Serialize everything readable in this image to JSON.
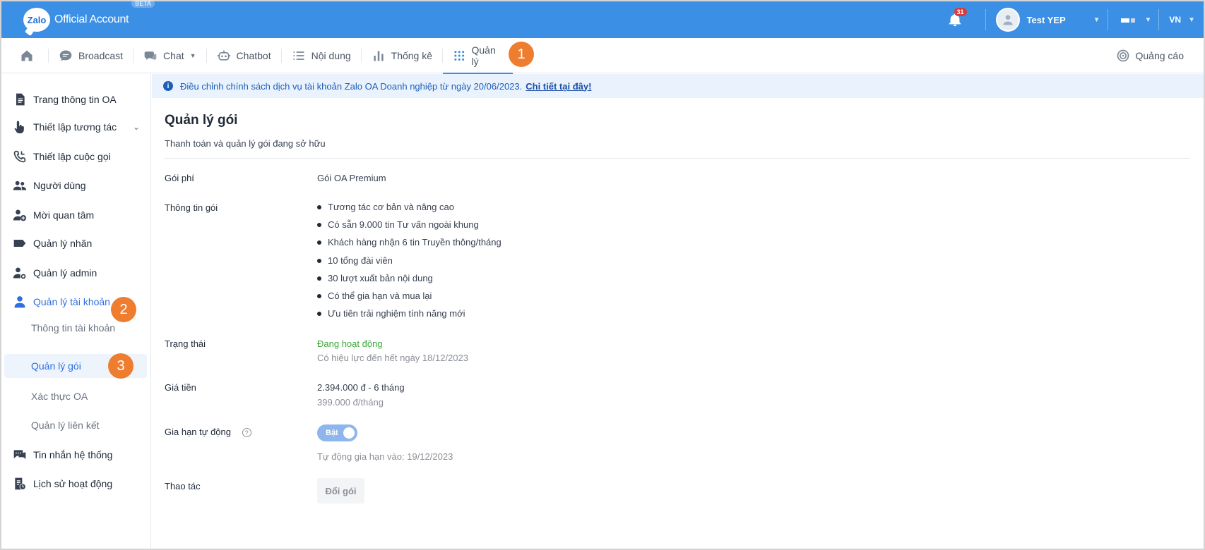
{
  "header": {
    "logo_text": "Zalo",
    "app_name": "Official Account",
    "beta": "BETA",
    "notification_count": "31",
    "user_name": "Test YEP",
    "language": "VN"
  },
  "nav": {
    "items": [
      {
        "label": "Broadcast"
      },
      {
        "label": "Chat"
      },
      {
        "label": "Chatbot"
      },
      {
        "label": "Nội dung"
      },
      {
        "label": "Thống kê"
      },
      {
        "label": "Quản lý"
      }
    ],
    "right_label": "Quảng cáo"
  },
  "callouts": [
    "1",
    "2",
    "3"
  ],
  "sidebar": {
    "items": [
      {
        "label": "Trang thông tin OA"
      },
      {
        "label": "Thiết lập tương tác"
      },
      {
        "label": "Thiết lập cuộc gọi"
      },
      {
        "label": "Người dùng"
      },
      {
        "label": "Mời quan tâm"
      },
      {
        "label": "Quản lý nhãn"
      },
      {
        "label": "Quản lý admin"
      },
      {
        "label": "Quản lý tài khoản"
      },
      {
        "label": "Thông tin tài khoản"
      },
      {
        "label": "Quản lý gói"
      },
      {
        "label": "Xác thực OA"
      },
      {
        "label": "Quản lý liên kết"
      },
      {
        "label": "Tin nhắn hệ thống"
      },
      {
        "label": "Lịch sử hoạt động"
      }
    ]
  },
  "banner": {
    "text": "Điều chỉnh chính sách dịch vụ tài khoản Zalo OA Doanh nghiệp từ ngày 20/06/2023.",
    "link": "Chi tiết tại đây!"
  },
  "main": {
    "title": "Quản lý gói",
    "subtitle": "Thanh toán và quản lý gói đang sở hữu",
    "fields": {
      "package_label": "Gói phí",
      "package_value": "Gói OA Premium",
      "info_label": "Thông tin gói",
      "info_items": [
        "Tương tác cơ bản và nâng cao",
        "Có sẵn 9.000 tin Tư vấn ngoài khung",
        "Khách hàng nhận 6 tin Truyền thông/tháng",
        "10 tổng đài viên",
        "30 lượt xuất bản nội dung",
        "Có thể gia hạn và mua lại",
        "Ưu tiên trải nghiệm tính năng mới"
      ],
      "status_label": "Trạng thái",
      "status_value": "Đang hoạt động",
      "status_note": "Có hiệu lực đến hết ngày 18/12/2023",
      "price_label": "Giá tiền",
      "price_value": "2.394.000 đ - 6 tháng",
      "price_note": "399.000 đ/tháng",
      "renew_label": "Gia hạn tự động",
      "renew_toggle": "Bật",
      "renew_note": "Tự động gia hạn vào: 19/12/2023",
      "action_label": "Thao tác",
      "action_button": "Đổi gói"
    }
  },
  "colors": {
    "header_bg": "#3b8fe4",
    "accent": "#2f6fe0",
    "callout": "#ee7d30",
    "status_green": "#3aa63a"
  }
}
